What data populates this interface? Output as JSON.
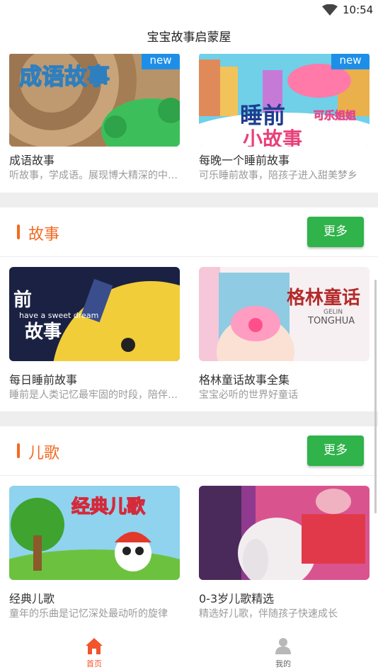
{
  "status": {
    "time": "10:54"
  },
  "app": {
    "title": "宝宝故事启蒙屋"
  },
  "badge": {
    "new": "new"
  },
  "top_cards": [
    {
      "title": "成语故事",
      "desc": "听故事，学成语。展现博大精深的中华文化"
    },
    {
      "title": "每晚一个睡前故事",
      "desc": "可乐睡前故事，陪孩子进入甜美梦乡"
    }
  ],
  "sections": [
    {
      "label": "故事",
      "more": "更多",
      "cards": [
        {
          "title": "每日睡前故事",
          "desc": "睡前是人类记忆最牢固的时段，陪伴宝宝"
        },
        {
          "title": "格林童话故事全集",
          "desc": "宝宝必听的世界好童话"
        }
      ]
    },
    {
      "label": "儿歌",
      "more": "更多",
      "cards": [
        {
          "title": "经典儿歌",
          "desc": "童年的乐曲是记忆深处最动听的旋律"
        },
        {
          "title": "0-3岁儿歌精选",
          "desc": "精选好儿歌，伴随孩子快速成长"
        }
      ]
    }
  ],
  "thumb_text": {
    "idiom": "成语故事",
    "bedtime_a": "睡前",
    "bedtime_b": "小故事",
    "bedtime_c": "可乐姐姐",
    "daily_a": "前",
    "daily_b": "have a sweet dream",
    "daily_c": "故事",
    "grimm_a": "格林童话",
    "grimm_b": "GELIN",
    "grimm_c": "TONGHUA",
    "songs": "经典儿歌"
  },
  "tabs": [
    {
      "label": "首页",
      "icon": "home-icon",
      "active": true
    },
    {
      "label": "我的",
      "icon": "person-icon",
      "active": false
    }
  ],
  "colors": {
    "accent": "#f36a21",
    "green": "#2fb34a",
    "badge": "#1e8fe8",
    "active_tab": "#f2542d"
  }
}
